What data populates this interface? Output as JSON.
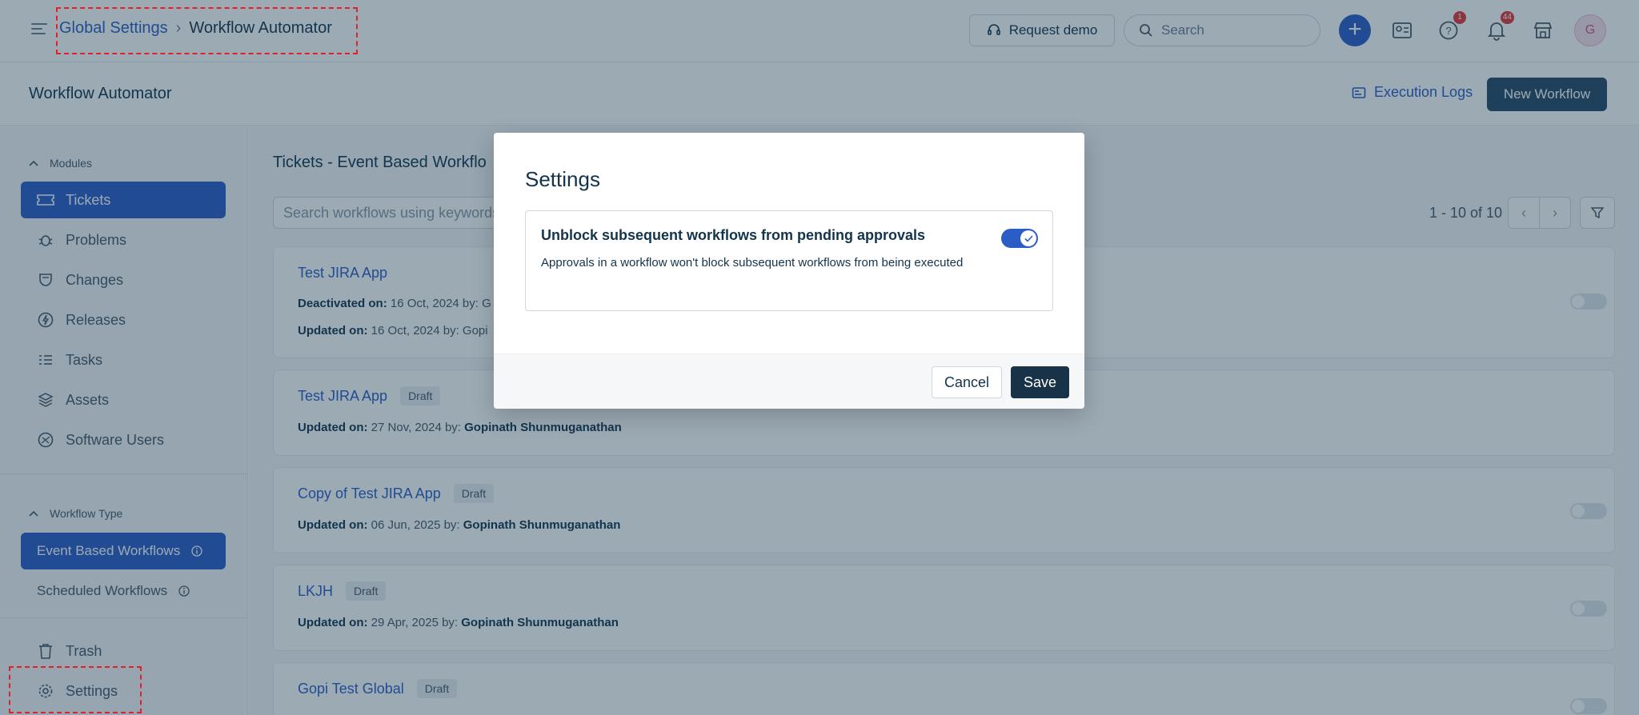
{
  "breadcrumb": {
    "parent": "Global Settings",
    "separator": "›",
    "current": "Workflow Automator"
  },
  "topbar": {
    "request_demo": "Request demo",
    "search_placeholder": "Search",
    "help_badge": "1",
    "notifications_badge": "44",
    "avatar_initial": "G"
  },
  "header": {
    "title": "Workflow Automator",
    "execution_logs": "Execution Logs",
    "new_workflow": "New Workflow"
  },
  "sidebar": {
    "modules_label": "Modules",
    "modules": [
      {
        "label": "Tickets",
        "icon": "ticket-icon",
        "active": true
      },
      {
        "label": "Problems",
        "icon": "bug-icon"
      },
      {
        "label": "Changes",
        "icon": "changes-icon"
      },
      {
        "label": "Releases",
        "icon": "releases-icon"
      },
      {
        "label": "Tasks",
        "icon": "tasks-icon"
      },
      {
        "label": "Assets",
        "icon": "assets-icon"
      },
      {
        "label": "Software Users",
        "icon": "software-users-icon"
      }
    ],
    "workflow_type_label": "Workflow Type",
    "workflow_types": [
      {
        "label": "Event Based Workflows",
        "active": true
      },
      {
        "label": "Scheduled Workflows"
      }
    ],
    "trash": "Trash",
    "settings": "Settings"
  },
  "main": {
    "list_title": "Tickets - Event Based Workflo",
    "search_placeholder": "Search workflows using keywords",
    "pagination": "1 - 10 of 10",
    "workflows": [
      {
        "name": "Test JIRA App",
        "badge": "",
        "line1_label": "Deactivated on:",
        "line1_value": "16 Oct, 2024 by: G",
        "line2_label": "Updated on:",
        "line2_value": "16 Oct, 2024 by: Gopi"
      },
      {
        "name": "Test JIRA App",
        "badge": "Draft",
        "line1_label": "Updated on:",
        "line1_value": "27 Nov, 2024 by:",
        "line1_by": "Gopinath Shunmuganathan"
      },
      {
        "name": "Copy of Test JIRA App",
        "badge": "Draft",
        "line1_label": "Updated on:",
        "line1_value": "06 Jun, 2025 by:",
        "line1_by": "Gopinath Shunmuganathan"
      },
      {
        "name": "LKJH",
        "badge": "Draft",
        "line1_label": "Updated on:",
        "line1_value": "29 Apr, 2025 by:",
        "line1_by": "Gopinath Shunmuganathan"
      },
      {
        "name": "Gopi Test Global",
        "badge": "Draft"
      }
    ]
  },
  "modal": {
    "title": "Settings",
    "setting_title": "Unblock subsequent workflows from pending approvals",
    "setting_description": "Approvals in a workflow won't block subsequent workflows from being executed",
    "toggle_enabled": true,
    "cancel": "Cancel",
    "save": "Save"
  },
  "colors": {
    "accent": "#2c5cc5",
    "primary_button": "#183247",
    "highlight_box": "#e0202a"
  }
}
